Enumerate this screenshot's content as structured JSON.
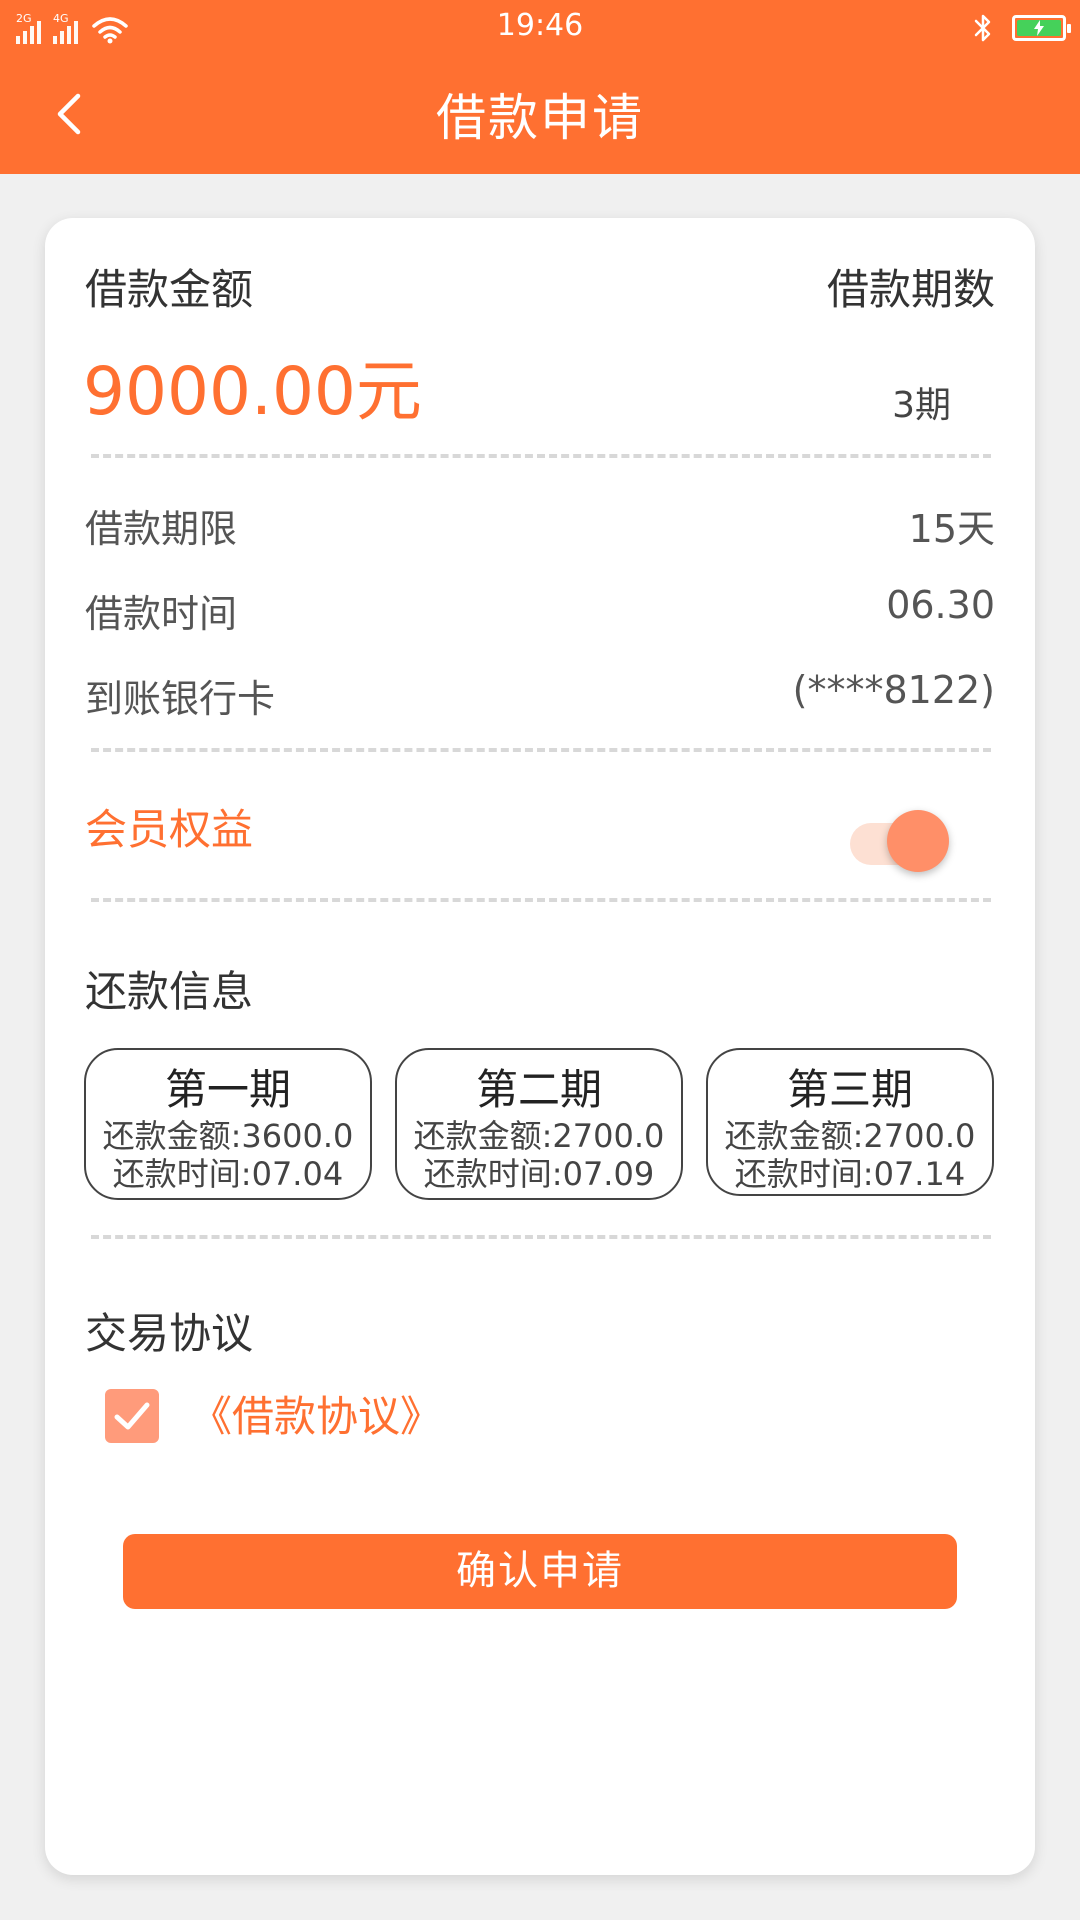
{
  "status_bar": {
    "network_1": "2G",
    "network_2": "4G",
    "time": "19:46"
  },
  "header": {
    "title": "借款申请"
  },
  "loan": {
    "amount_label": "借款金额",
    "amount_value": "9000.00元",
    "periods_label": "借款期数",
    "periods_value": "3期"
  },
  "details": [
    {
      "label": "借款期限",
      "value": "15天"
    },
    {
      "label": "借款时间",
      "value": "06.30"
    },
    {
      "label": "到账银行卡",
      "value": "(****8122)"
    }
  ],
  "membership": {
    "label": "会员权益",
    "enabled": true
  },
  "repayment": {
    "title": "还款信息",
    "periods": [
      {
        "name": "第一期",
        "amount": "还款金额:3600.0",
        "date": "还款时间:07.04"
      },
      {
        "name": "第二期",
        "amount": "还款金额:2700.0",
        "date": "还款时间:07.09"
      },
      {
        "name": "第三期",
        "amount": "还款金额:2700.0",
        "date": "还款时间:07.14"
      }
    ]
  },
  "agreement": {
    "title": "交易协议",
    "checked": true,
    "link_text": "《借款协议》"
  },
  "submit_label": "确认申请",
  "colors": {
    "accent": "#ff7031",
    "toggle_knob": "#ff8f68",
    "checkbox": "#ff9b7b"
  }
}
